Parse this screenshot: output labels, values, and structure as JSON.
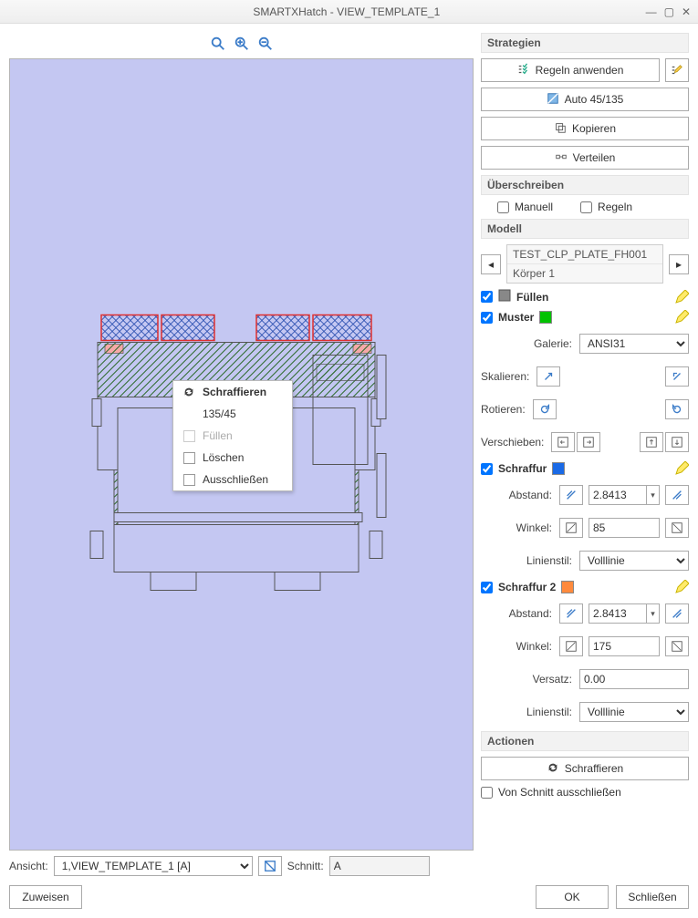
{
  "window": {
    "title": "SMARTXHatch  -  VIEW_TEMPLATE_1",
    "controls": {
      "min": "—",
      "max": "▢",
      "close": "✕"
    }
  },
  "zoom": {
    "fit": "zoom-fit",
    "in": "zoom-in",
    "out": "zoom-out"
  },
  "context_menu": {
    "hatch": "Schraffieren",
    "swap": "135/45",
    "fill": "Füllen",
    "delete": "Löschen",
    "exclude": "Ausschließen"
  },
  "below": {
    "view_label": "Ansicht:",
    "view_value": "1,VIEW_TEMPLATE_1 [A]",
    "section_label": "Schnitt:",
    "section_value": "A"
  },
  "panel": {
    "strategies": {
      "header": "Strategien",
      "apply_rules": "Regeln anwenden",
      "auto4545": "Auto 45/135",
      "copy": "Kopieren",
      "distribute": "Verteilen"
    },
    "override": {
      "header": "Überschreiben",
      "manual": "Manuell",
      "rules": "Regeln"
    },
    "model": {
      "header": "Modell",
      "name": "TEST_CLP_PLATE_FH001",
      "body": "Körper 1"
    },
    "fill": {
      "label": "Füllen"
    },
    "pattern": {
      "label": "Muster",
      "color": "#00c200",
      "gallery_label": "Galerie:",
      "gallery_value": "ANSI31",
      "scale_label": "Skalieren:",
      "rotate_label": "Rotieren:",
      "shift_label": "Verschieben:"
    },
    "hatch1": {
      "label": "Schraffur",
      "color": "#1a6ae6",
      "dist_label": "Abstand:",
      "dist_value": "2.8413",
      "angle_label": "Winkel:",
      "angle_value": "85",
      "style_label": "Linienstil:",
      "style_value": "Volllinie"
    },
    "hatch2": {
      "label": "Schraffur 2",
      "color": "#ff8a3d",
      "dist_label": "Abstand:",
      "dist_value": "2.8413",
      "angle_label": "Winkel:",
      "angle_value": "175",
      "offset_label": "Versatz:",
      "offset_value": "0.00",
      "style_label": "Linienstil:",
      "style_value": "Volllinie"
    },
    "actions": {
      "header": "Actionen",
      "hatch_btn": "Schraffieren",
      "exclude_cb": "Von Schnitt ausschließen"
    }
  },
  "footer": {
    "assign": "Zuweisen",
    "ok": "OK",
    "close": "Schließen"
  }
}
